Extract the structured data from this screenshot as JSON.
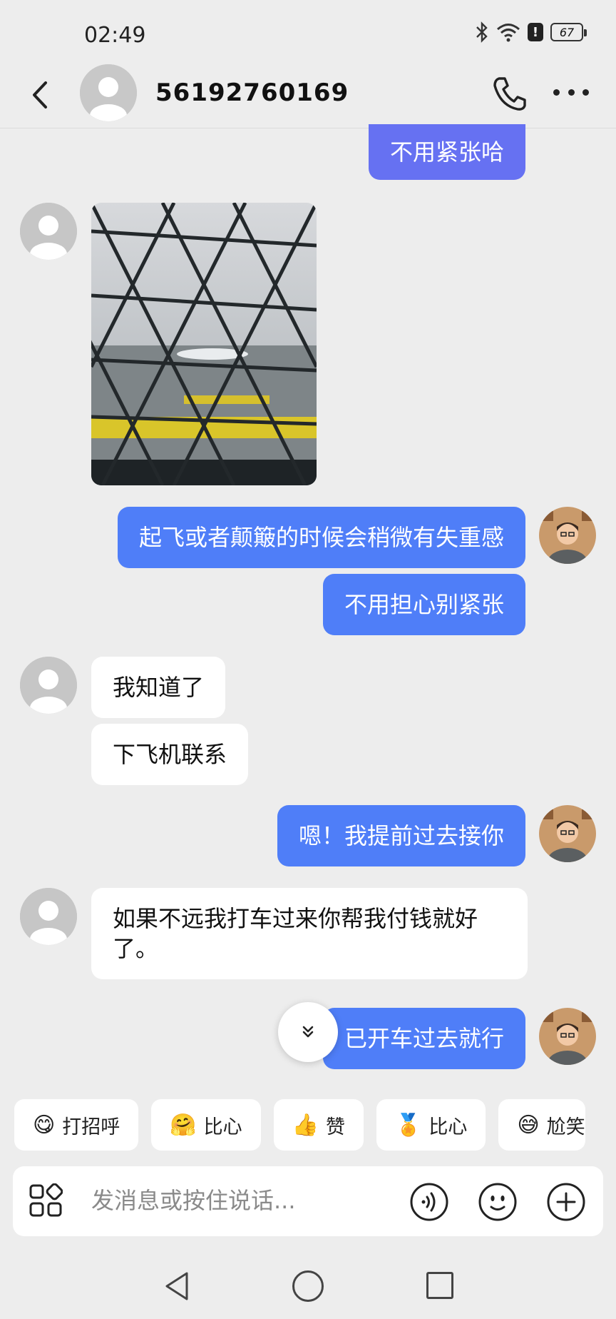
{
  "status_bar": {
    "time": "02:49",
    "battery": "67"
  },
  "header": {
    "contact_name": "56192760169"
  },
  "messages": [
    {
      "side": "out",
      "text": "不用紧张哈"
    },
    {
      "side": "in",
      "type": "image"
    },
    {
      "side": "out",
      "text": "起飞或者颠簸的时候会稍微有失重感"
    },
    {
      "side": "out",
      "text": "不用担心别紧张"
    },
    {
      "side": "in",
      "text": "我知道了"
    },
    {
      "side": "in",
      "text": "下飞机联系"
    },
    {
      "side": "out",
      "text": "嗯！我提前过去接你"
    },
    {
      "side": "in",
      "text": "如果不远我打车过来你帮我付钱就好了。"
    },
    {
      "side": "out",
      "text": "已开车过去就行"
    }
  ],
  "quick_replies": [
    {
      "emoji": "😋",
      "label": "打招呼"
    },
    {
      "emoji": "🤗",
      "label": "比心"
    },
    {
      "emoji": "👍",
      "label": "赞"
    },
    {
      "emoji": "🏅",
      "label": "比心"
    },
    {
      "emoji": "😅",
      "label": "尬笑"
    }
  ],
  "input": {
    "placeholder": "发消息或按住说话..."
  },
  "colors": {
    "bubble_out": "#4f7ef8",
    "bubble_in": "#ffffff",
    "background": "#ededed"
  }
}
